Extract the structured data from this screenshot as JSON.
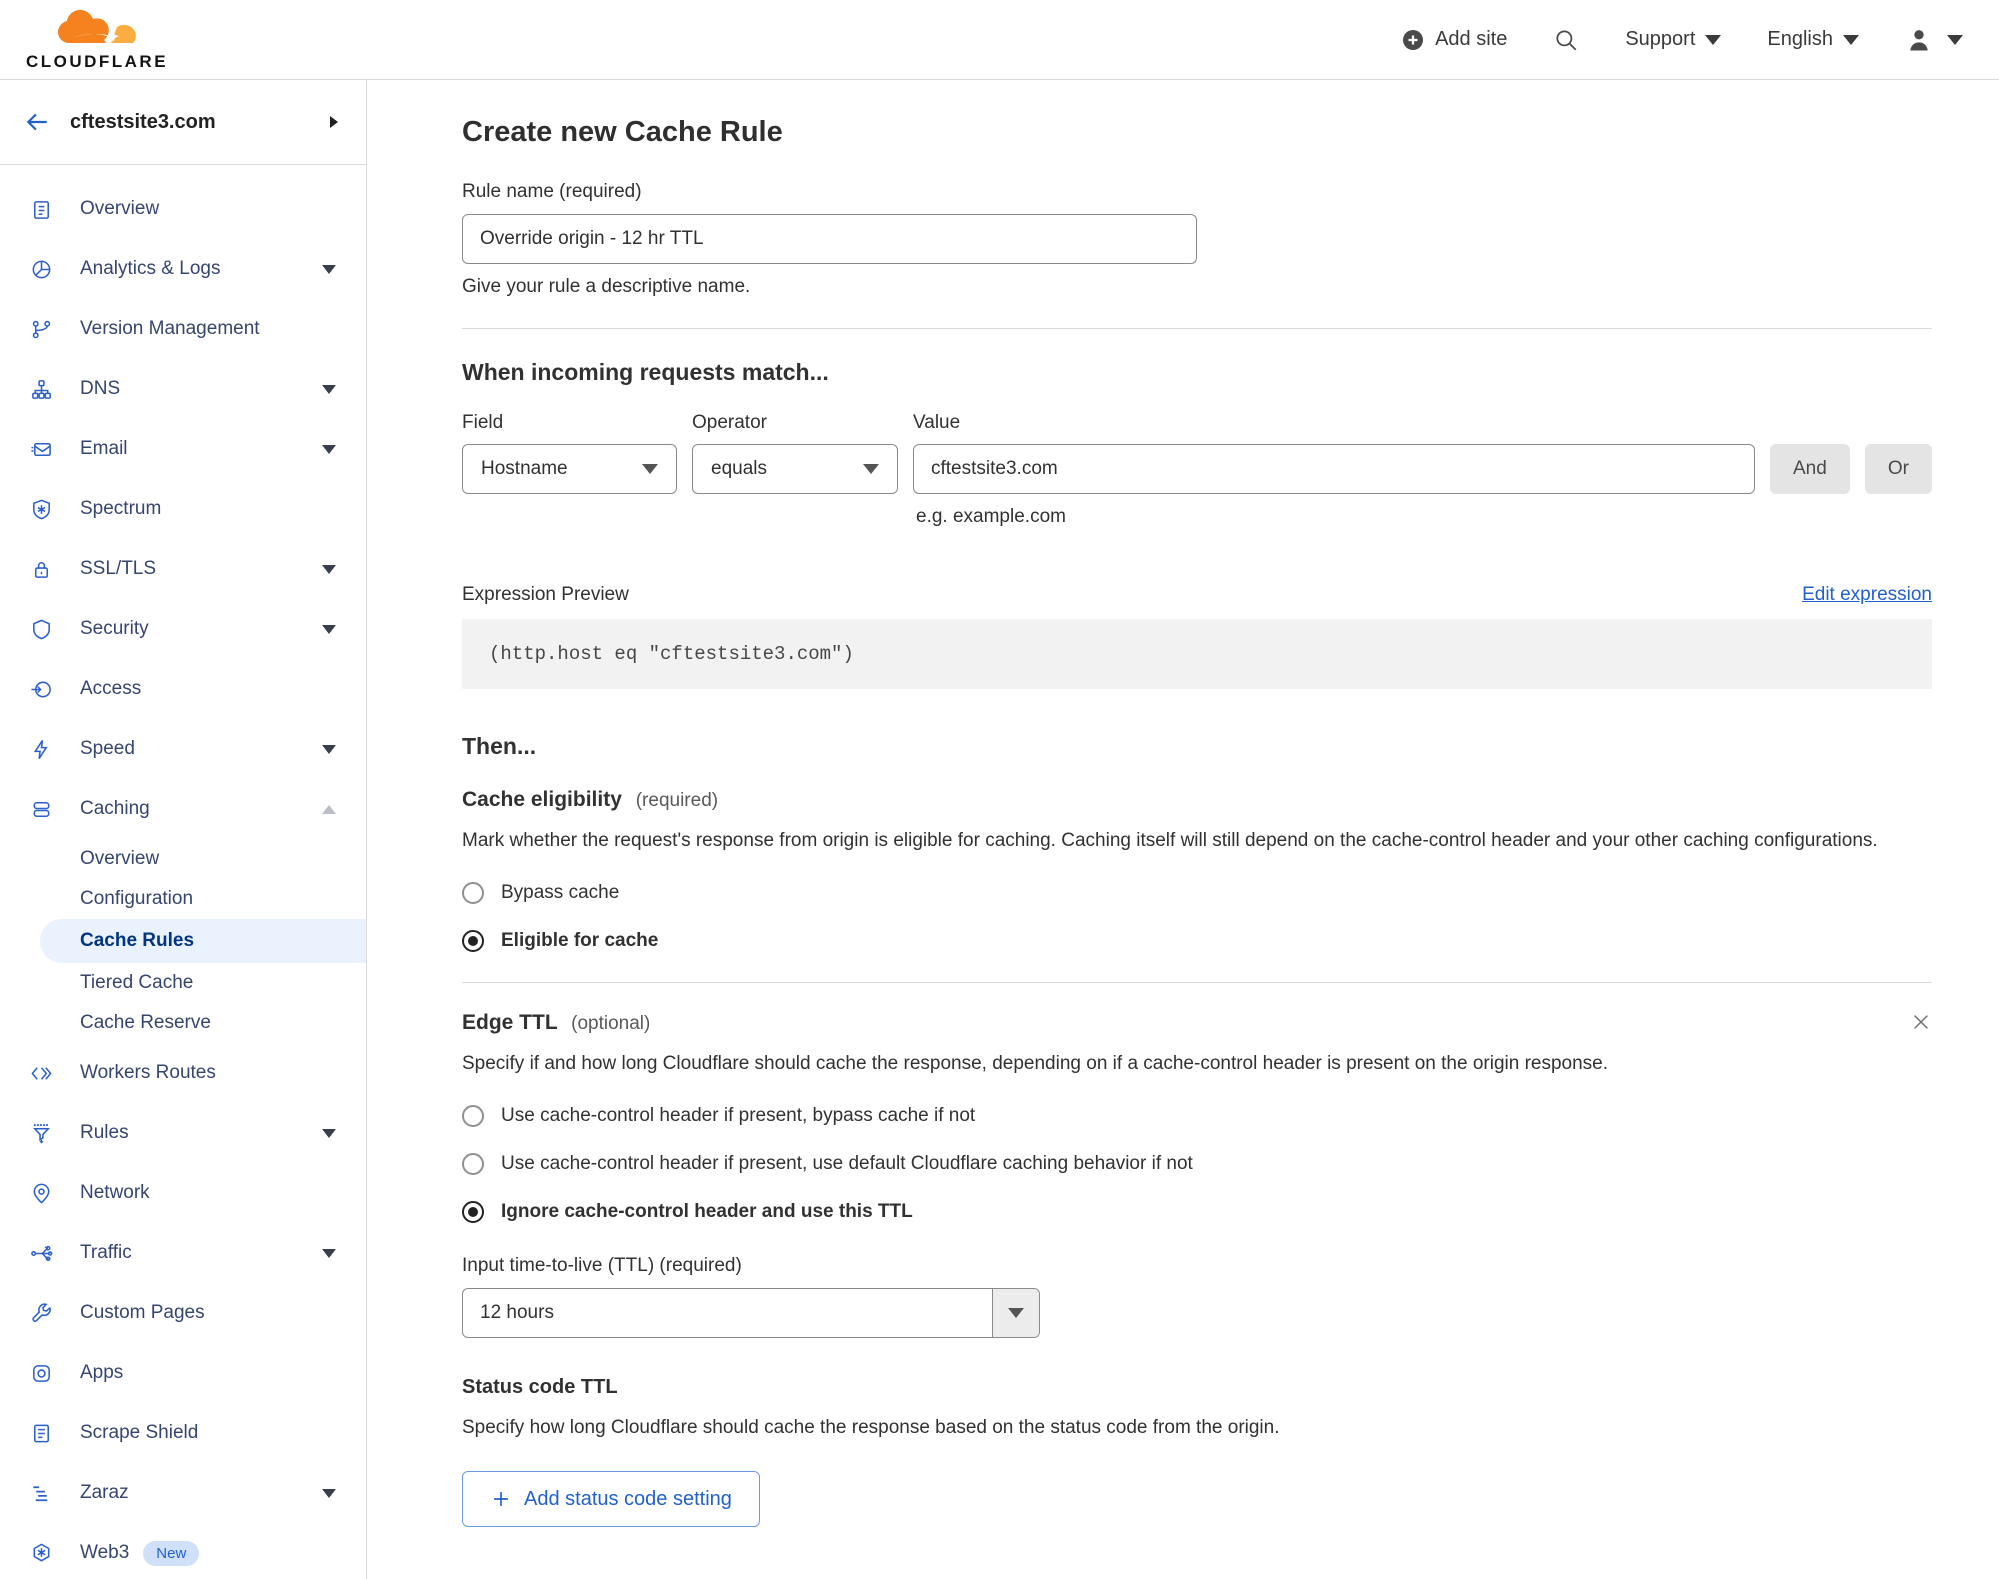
{
  "header": {
    "logo_word": "CLOUDFLARE",
    "add_site": "Add site",
    "support": "Support",
    "language": "English"
  },
  "sidebar": {
    "site_name": "cftestsite3.com",
    "items": [
      {
        "label": "Overview",
        "icon": "overview-icon",
        "type": "main"
      },
      {
        "label": "Analytics & Logs",
        "icon": "analytics-icon",
        "type": "main",
        "chevron": "down"
      },
      {
        "label": "Version Management",
        "icon": "version-management-icon",
        "type": "main"
      },
      {
        "label": "DNS",
        "icon": "dns-icon",
        "type": "main",
        "chevron": "down"
      },
      {
        "label": "Email",
        "icon": "email-icon",
        "type": "main",
        "chevron": "down"
      },
      {
        "label": "Spectrum",
        "icon": "spectrum-icon",
        "type": "main"
      },
      {
        "label": "SSL/TLS",
        "icon": "ssl-tls-icon",
        "type": "main",
        "chevron": "down"
      },
      {
        "label": "Security",
        "icon": "security-icon",
        "type": "main",
        "chevron": "down"
      },
      {
        "label": "Access",
        "icon": "access-icon",
        "type": "main"
      },
      {
        "label": "Speed",
        "icon": "speed-icon",
        "type": "main",
        "chevron": "down"
      },
      {
        "label": "Caching",
        "icon": "caching-icon",
        "type": "main",
        "chevron": "up",
        "expanded": true
      },
      {
        "label": "Overview",
        "type": "sub"
      },
      {
        "label": "Configuration",
        "type": "sub"
      },
      {
        "label": "Cache Rules",
        "type": "sub",
        "active": true
      },
      {
        "label": "Tiered Cache",
        "type": "sub"
      },
      {
        "label": "Cache Reserve",
        "type": "sub"
      },
      {
        "label": "Workers Routes",
        "icon": "workers-routes-icon",
        "type": "main"
      },
      {
        "label": "Rules",
        "icon": "rules-icon",
        "type": "main",
        "chevron": "down"
      },
      {
        "label": "Network",
        "icon": "network-icon",
        "type": "main"
      },
      {
        "label": "Traffic",
        "icon": "traffic-icon",
        "type": "main",
        "chevron": "down"
      },
      {
        "label": "Custom Pages",
        "icon": "custom-pages-icon",
        "type": "main"
      },
      {
        "label": "Apps",
        "icon": "apps-icon",
        "type": "main"
      },
      {
        "label": "Scrape Shield",
        "icon": "scrape-shield-icon",
        "type": "main"
      },
      {
        "label": "Zaraz",
        "icon": "zaraz-icon",
        "type": "main",
        "chevron": "down"
      },
      {
        "label": "Web3",
        "icon": "web3-icon",
        "type": "main",
        "badge": "New"
      }
    ]
  },
  "main": {
    "title": "Create new Cache Rule",
    "rule_name": {
      "label": "Rule name (required)",
      "value": "Override origin - 12 hr TTL",
      "help": "Give your rule a descriptive name."
    },
    "match": {
      "heading": "When incoming requests match...",
      "field_label": "Field",
      "field_value": "Hostname",
      "operator_label": "Operator",
      "operator_value": "equals",
      "value_label": "Value",
      "value_value": "cftestsite3.com",
      "value_help": "e.g. example.com",
      "and_label": "And",
      "or_label": "Or"
    },
    "expression": {
      "label": "Expression Preview",
      "edit_link": "Edit expression",
      "code": "(http.host eq \"cftestsite3.com\")"
    },
    "then_heading": "Then...",
    "cache_eligibility": {
      "heading": "Cache eligibility",
      "tag": "(required)",
      "description": "Mark whether the request's response from origin is eligible for caching. Caching itself will still depend on the cache-control header and your other caching configurations.",
      "options": [
        {
          "label": "Bypass cache",
          "selected": false
        },
        {
          "label": "Eligible for cache",
          "selected": true
        }
      ]
    },
    "edge_ttl": {
      "heading": "Edge TTL",
      "tag": "(optional)",
      "description": "Specify if and how long Cloudflare should cache the response, depending on if a cache-control header is present on the origin response.",
      "options": [
        {
          "label": "Use cache-control header if present, bypass cache if not",
          "selected": false
        },
        {
          "label": "Use cache-control header if present, use default Cloudflare caching behavior if not",
          "selected": false
        },
        {
          "label": "Ignore cache-control header and use this TTL",
          "selected": true
        }
      ],
      "ttl_label": "Input time-to-live (TTL) (required)",
      "ttl_value": "12 hours"
    },
    "status_code_ttl": {
      "heading": "Status code TTL",
      "description": "Specify how long Cloudflare should cache the response based on the status code from the origin.",
      "add_button": "Add status code setting"
    }
  },
  "colors": {
    "brand_orange": "#f6821f",
    "brand_orange_light": "#fbad41",
    "link_blue": "#2260cb",
    "sidebar_icon_blue": "#2c5fc9",
    "sidebar_text": "#36456e",
    "active_pill_bg": "#e9f2fd",
    "active_pill_text": "#003681",
    "divider": "#d9d9d9",
    "code_bg": "#f2f2f2",
    "gray_button_bg": "#e4e4e4"
  }
}
